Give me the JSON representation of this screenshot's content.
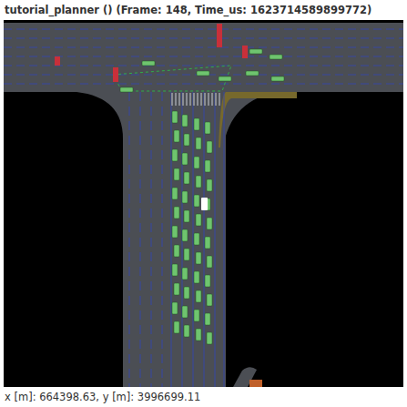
{
  "window": {
    "title": "tutorial_planner () (Frame: 148, Time_us: 1623714589899772)"
  },
  "status_bar": {
    "coordinates": "x [m]: 664398.63, y [m]: 3996699.11"
  },
  "map": {
    "ego": {
      "color": "#ffffff"
    },
    "agents": [
      {
        "color": "#6fc46f"
      },
      {
        "color": "#6fc46f"
      },
      {
        "color": "#6fc46f"
      },
      {
        "color": "#6fc46f"
      },
      {
        "color": "#6fc46f"
      },
      {
        "color": "#6fc46f"
      },
      {
        "color": "#6fc46f"
      },
      {
        "color": "#6fc46f"
      },
      {
        "color": "#6fc46f"
      },
      {
        "color": "#6fc46f"
      },
      {
        "color": "#6fc46f"
      },
      {
        "color": "#6fc46f"
      },
      {
        "color": "#6fc46f"
      },
      {
        "color": "#6fc46f"
      },
      {
        "color": "#6fc46f"
      },
      {
        "color": "#6fc46f"
      },
      {
        "color": "#6fc46f"
      },
      {
        "color": "#6fc46f"
      },
      {
        "color": "#6fc46f"
      },
      {
        "color": "#6fc46f"
      },
      {
        "color": "#6fc46f"
      },
      {
        "color": "#6fc46f"
      },
      {
        "color": "#6fc46f"
      },
      {
        "color": "#6fc46f"
      },
      {
        "color": "#6fc46f"
      },
      {
        "color": "#6fc46f"
      },
      {
        "color": "#6fc46f"
      },
      {
        "color": "#6fc46f"
      },
      {
        "color": "#6fc46f"
      },
      {
        "color": "#6fc46f"
      },
      {
        "color": "#6fc46f"
      },
      {
        "color": "#6fc46f"
      },
      {
        "color": "#6fc46f"
      },
      {
        "color": "#6fc46f"
      },
      {
        "color": "#6fc46f"
      },
      {
        "color": "#6fc46f"
      },
      {
        "color": "#6fc46f"
      },
      {
        "color": "#6fc46f"
      },
      {
        "color": "#6fc46f"
      },
      {
        "color": "#6fc46f"
      },
      {
        "color": "#6fc46f"
      },
      {
        "color": "#6fc46f"
      },
      {
        "color": "#6fc46f"
      },
      {
        "color": "#6fc46f"
      },
      {
        "color": "#6fc46f"
      },
      {
        "color": "#6fc46f"
      },
      {
        "color": "#6fc46f"
      },
      {
        "color": "#6fc46f"
      }
    ],
    "cross_agents": [
      {
        "color": "#6fc46f"
      },
      {
        "color": "#6fc46f"
      },
      {
        "color": "#6fc46f"
      },
      {
        "color": "#6fc46f"
      },
      {
        "color": "#6fc46f"
      },
      {
        "color": "#6fc46f"
      },
      {
        "color": "#6fc46f"
      },
      {
        "color": "#6fc46f"
      }
    ],
    "signals": [
      {
        "color": "#c8303a"
      },
      {
        "color": "#c8303a"
      },
      {
        "color": "#c8303a"
      },
      {
        "color": "#c8303a"
      }
    ]
  }
}
